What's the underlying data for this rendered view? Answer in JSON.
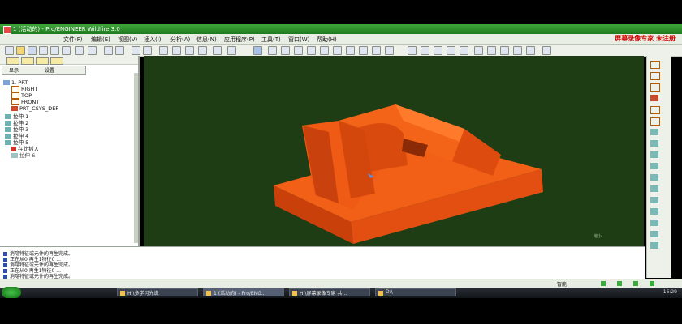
{
  "window": {
    "title": "1 (活动的) - Pro/ENGINEER Wildfire 3.0",
    "watermark": "屏幕录像专家  未注册"
  },
  "menu": [
    "文件(F)",
    "编辑(E)",
    "视图(V)",
    "插入(I)",
    "分析(A)",
    "信息(N)",
    "应用程序(P)",
    "工具(T)",
    "窗口(W)",
    "帮助(H)"
  ],
  "left_panel": {
    "show_label": "显示",
    "settings_label": "设置"
  },
  "tree": [
    {
      "label": "1. PRT",
      "icon": "part-icon"
    },
    {
      "label": "RIGHT",
      "icon": "datum-plane-icon"
    },
    {
      "label": "TOP",
      "icon": "datum-plane-icon"
    },
    {
      "label": "FRONT",
      "icon": "datum-plane-icon"
    },
    {
      "label": "PRT_CSYS_DEF",
      "icon": "csys-icon"
    },
    {
      "label": "拉伸 1",
      "icon": "extrude-icon"
    },
    {
      "label": "拉伸 2",
      "icon": "extrude-icon"
    },
    {
      "label": "拉伸 3",
      "icon": "extrude-icon"
    },
    {
      "label": "拉伸 4",
      "icon": "extrude-icon"
    },
    {
      "label": "拉伸 5",
      "icon": "extrude-icon"
    },
    {
      "label": "在此插入",
      "icon": "insert-here-icon"
    },
    {
      "label": "拉伸 6",
      "icon": "extrude-icon"
    }
  ],
  "messages": [
    "消隐特征或元件的再生完成。",
    "正在从0 再生1特征0 ...",
    "消隐特征或元件的再生完成。",
    "正在从0 再生1特征0 ...",
    "消隐特征或元件的再生完成。"
  ],
  "status": {
    "filter": "智能"
  },
  "viewport": {
    "corner_label": "缩小 "
  },
  "taskbar": {
    "tasks": [
      "H:\\多学习光说",
      "1 (活动的) - Pro/ENG...",
      "H:\\屏幕录像专家 共...",
      "D:\\"
    ],
    "clock": "16:29"
  },
  "colors": {
    "model": "#e8520f",
    "viewport_bg": "#1f3d15",
    "title_green": "#2f8f2c"
  }
}
